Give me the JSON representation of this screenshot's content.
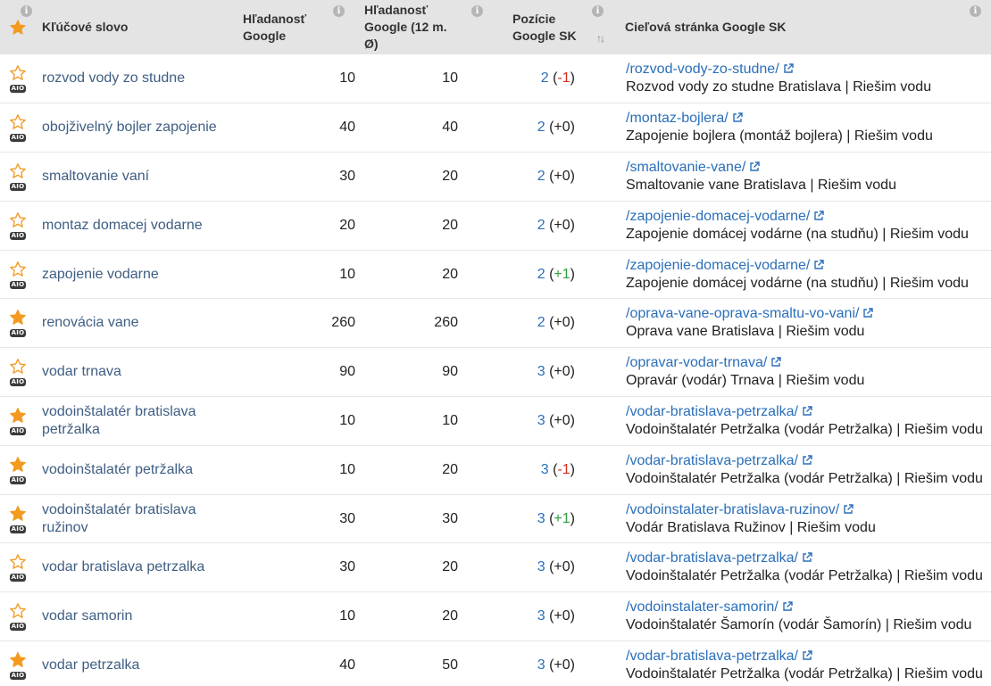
{
  "header": {
    "star_icon": "star-icon",
    "keyword": "Kľúčové slovo",
    "volume": "Hľadanosť Google",
    "volume12": "Hľadanosť Google (12 m. Ø)",
    "position": "Pozície Google SK",
    "target": "Cieľová stránka Google SK",
    "info_glyph": "i",
    "sort_glyph": "↑↓"
  },
  "colors": {
    "star_filled": "#f39a1f",
    "star_outline": "#f39a1f",
    "link": "#2b6fb9",
    "keyword": "#3f5e82",
    "negative": "#d62c1a",
    "positive": "#2e9e3e",
    "header_bg": "#e4e4e4"
  },
  "aio_label": "AIO",
  "rows": [
    {
      "starred": false,
      "keyword": "rozvod vody zo studne",
      "volume": "10",
      "volume12": "10",
      "position": "2",
      "change": "-1",
      "change_type": "neg",
      "url": "/rozvod-vody-zo-studne/",
      "title": "Rozvod vody zo studne Bratislava | Riešim vodu"
    },
    {
      "starred": false,
      "keyword": "obojživelný bojler zapojenie",
      "volume": "40",
      "volume12": "40",
      "position": "2",
      "change": "+0",
      "change_type": "neu",
      "url": "/montaz-bojlera/",
      "title": "Zapojenie bojlera (montáž bojlera) | Riešim vodu"
    },
    {
      "starred": false,
      "keyword": "smaltovanie vaní",
      "volume": "30",
      "volume12": "20",
      "position": "2",
      "change": "+0",
      "change_type": "neu",
      "url": "/smaltovanie-vane/",
      "title": "Smaltovanie vane Bratislava | Riešim vodu"
    },
    {
      "starred": false,
      "keyword": "montaz domacej vodarne",
      "volume": "20",
      "volume12": "20",
      "position": "2",
      "change": "+0",
      "change_type": "neu",
      "url": "/zapojenie-domacej-vodarne/",
      "title": "Zapojenie domácej vodárne (na studňu) | Riešim vodu"
    },
    {
      "starred": false,
      "keyword": "zapojenie vodarne",
      "volume": "10",
      "volume12": "20",
      "position": "2",
      "change": "+1",
      "change_type": "pos",
      "url": "/zapojenie-domacej-vodarne/",
      "title": "Zapojenie domácej vodárne (na studňu) | Riešim vodu"
    },
    {
      "starred": true,
      "keyword": "renovácia vane",
      "volume": "260",
      "volume12": "260",
      "position": "2",
      "change": "+0",
      "change_type": "neu",
      "url": "/oprava-vane-oprava-smaltu-vo-vani/",
      "title": "Oprava vane Bratislava | Riešim vodu"
    },
    {
      "starred": false,
      "keyword": "vodar trnava",
      "volume": "90",
      "volume12": "90",
      "position": "3",
      "change": "+0",
      "change_type": "neu",
      "url": "/opravar-vodar-trnava/",
      "title": "Opravár (vodár) Trnava | Riešim vodu"
    },
    {
      "starred": true,
      "keyword": "vodoinštalatér bratislava petržalka",
      "volume": "10",
      "volume12": "10",
      "position": "3",
      "change": "+0",
      "change_type": "neu",
      "url": "/vodar-bratislava-petrzalka/",
      "title": "Vodoinštalatér Petržalka (vodár Petržalka) | Riešim vodu"
    },
    {
      "starred": true,
      "keyword": "vodoinštalatér petržalka",
      "volume": "10",
      "volume12": "20",
      "position": "3",
      "change": "-1",
      "change_type": "neg",
      "url": "/vodar-bratislava-petrzalka/",
      "title": "Vodoinštalatér Petržalka (vodár Petržalka) | Riešim vodu"
    },
    {
      "starred": true,
      "keyword": "vodoinštalatér bratislava ružinov",
      "volume": "30",
      "volume12": "30",
      "position": "3",
      "change": "+1",
      "change_type": "pos",
      "url": "/vodoinstalater-bratislava-ruzinov/",
      "title": "Vodár Bratislava Ružinov | Riešim vodu"
    },
    {
      "starred": false,
      "keyword": "vodar bratislava petrzalka",
      "volume": "30",
      "volume12": "20",
      "position": "3",
      "change": "+0",
      "change_type": "neu",
      "url": "/vodar-bratislava-petrzalka/",
      "title": "Vodoinštalatér Petržalka (vodár Petržalka) | Riešim vodu"
    },
    {
      "starred": false,
      "keyword": "vodar samorin",
      "volume": "10",
      "volume12": "20",
      "position": "3",
      "change": "+0",
      "change_type": "neu",
      "url": "/vodoinstalater-samorin/",
      "title": "Vodoinštalatér Šamorín (vodár Šamorín) | Riešim vodu"
    },
    {
      "starred": true,
      "keyword": "vodar petrzalka",
      "volume": "40",
      "volume12": "50",
      "position": "3",
      "change": "+0",
      "change_type": "neu",
      "url": "/vodar-bratislava-petrzalka/",
      "title": "Vodoinštalatér Petržalka (vodár Petržalka) | Riešim vodu"
    }
  ]
}
